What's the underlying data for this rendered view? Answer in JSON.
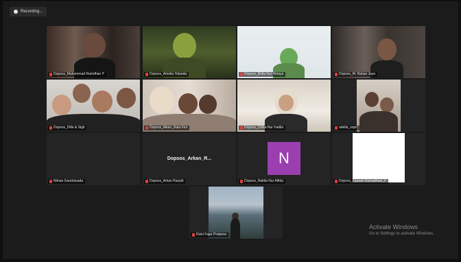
{
  "recording": {
    "label": "Recording..."
  },
  "participants": [
    {
      "name": "Dopsos_Muhammad Ramdhan P"
    },
    {
      "name": "Dopsos_Amelia Yolanda"
    },
    {
      "name": "Dopsos_Bella Nur Hidaya"
    },
    {
      "name": "Dopsos_M. Rakan Jaya"
    },
    {
      "name": "Dopsos_Dilla & Sigit"
    },
    {
      "name": "Dopsos_Aikan_Ratu Fini"
    },
    {
      "name": "Dopsos_Chika Nur Fadila"
    },
    {
      "name": "adella_sopri"
    },
    {
      "name": "Nimas Gandrasada"
    },
    {
      "name": "Dopsos_Arkan Rasyid",
      "display_name": "Dopsos_Arkan_R..."
    },
    {
      "name": "Dopsos_Nabila Nur Alfida",
      "initial": "N"
    },
    {
      "name": "Dopsos_Fauzan Ramadhani_F"
    },
    {
      "name": "Rizki Fajar Pratama"
    }
  ],
  "watermark": {
    "title": "Activate Windows",
    "subtitle": "Go to Settings to activate Windows."
  },
  "colors": {
    "active_speaker_border": "#d7e36a",
    "avatar_purple": "#9b3fb0",
    "muted_mic": "#e04040"
  }
}
